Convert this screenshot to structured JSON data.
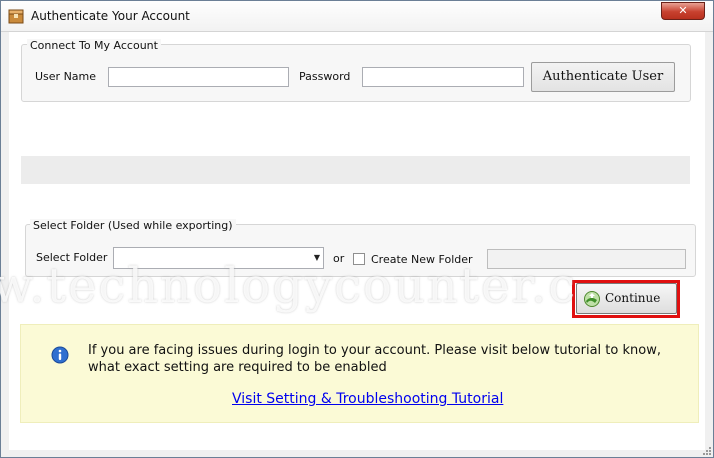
{
  "window": {
    "title": "Authenticate Your Account",
    "app_icon": "app-box-icon",
    "close_label": "✕"
  },
  "connect": {
    "group_title": "Connect To My Account",
    "username_label": "User Name",
    "username_value": "",
    "password_label": "Password",
    "password_value": "",
    "authenticate_label": "Authenticate User"
  },
  "folder": {
    "group_title": "Select Folder (Used while exporting)",
    "select_label": "Select Folder",
    "selected_value": "",
    "or_label": "or",
    "create_new_label": "Create New Folder",
    "create_new_checked": false,
    "new_folder_value": ""
  },
  "actions": {
    "continue_label": "Continue",
    "continue_icon": "globe-arrow-icon"
  },
  "info": {
    "icon": "info-icon",
    "message": "If you are facing issues during login to your account. Please visit below tutorial to know, what exact setting are required to be enabled",
    "link_label": "Visit Setting & Troubleshooting Tutorial"
  },
  "watermark": {
    "text": "w.technologycounter.c"
  },
  "colors": {
    "highlight_frame": "#e01010",
    "info_background": "#fbfad6",
    "link": "#0000ee"
  }
}
